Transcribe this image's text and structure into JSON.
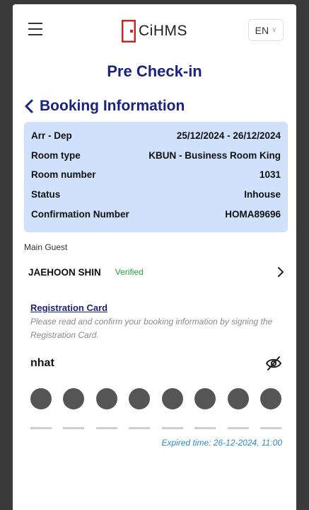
{
  "header": {
    "logo_text": "CiHMS",
    "language": "EN",
    "brand_color": "#c62828"
  },
  "page": {
    "title": "Pre Check-in",
    "section_title": "Booking Information"
  },
  "booking": {
    "rows": [
      {
        "label": "Arr - Dep",
        "value": "25/12/2024 - 26/12/2024"
      },
      {
        "label": "Room type",
        "value": "KBUN - Business Room King"
      },
      {
        "label": "Room number",
        "value": "1031"
      },
      {
        "label": "Status",
        "value": "Inhouse"
      },
      {
        "label": "Confirmation Number",
        "value": "HOMA89696"
      }
    ]
  },
  "guest": {
    "section_label": "Main Guest",
    "name": "JAEHOON SHIN",
    "status": "Verified"
  },
  "registration": {
    "link": "Registration Card",
    "note": "Please read and confirm your booking information by signing the Registration Card."
  },
  "pin": {
    "label": "nhat",
    "digits_count_shown": 8
  },
  "expiry": {
    "text": "Expired time: 26-12-2024, 11:00"
  },
  "colors": {
    "title": "#1a237e",
    "info_box_bg": "#cfe1fb",
    "verified": "#2e9e3f",
    "expired": "#2a8ad6"
  }
}
